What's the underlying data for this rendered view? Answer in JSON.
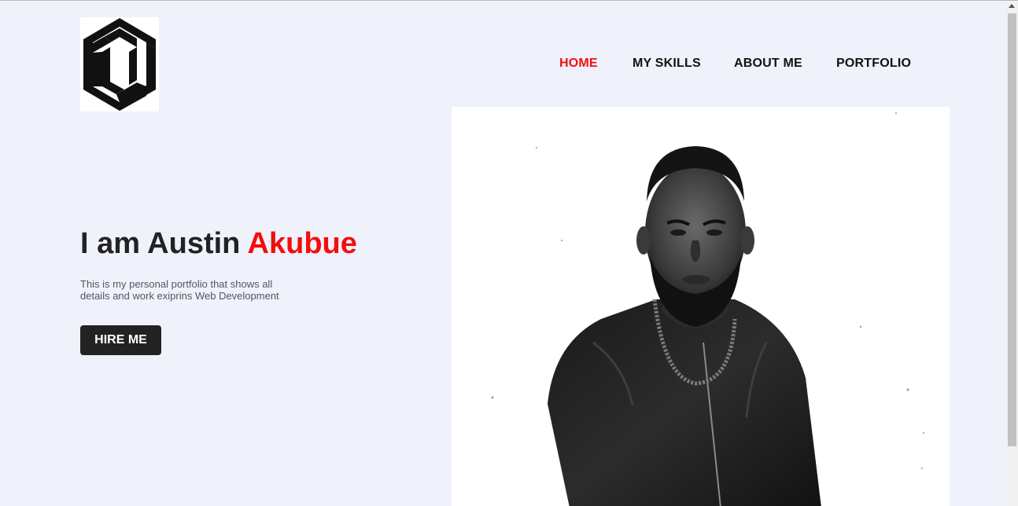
{
  "nav": {
    "items": [
      {
        "label": "HOME",
        "active": true
      },
      {
        "label": "MY SKILLS",
        "active": false
      },
      {
        "label": "ABOUT ME",
        "active": false
      },
      {
        "label": "PORTFOLIO",
        "active": false
      }
    ]
  },
  "hero": {
    "title_prefix": "I am Austin ",
    "title_accent": "Akubue",
    "description": "This is my personal portfolio that shows all details and work exiprins Web Development",
    "cta_label": "HIRE ME"
  },
  "logo": {
    "icon": "hexagon-logo-icon"
  },
  "photo": {
    "subject": "portrait-photo"
  },
  "colors": {
    "background": "#eff1fb",
    "accent": "#ee1111",
    "text_dark": "#222222",
    "button_bg": "#222222",
    "button_text": "#ffffff"
  }
}
